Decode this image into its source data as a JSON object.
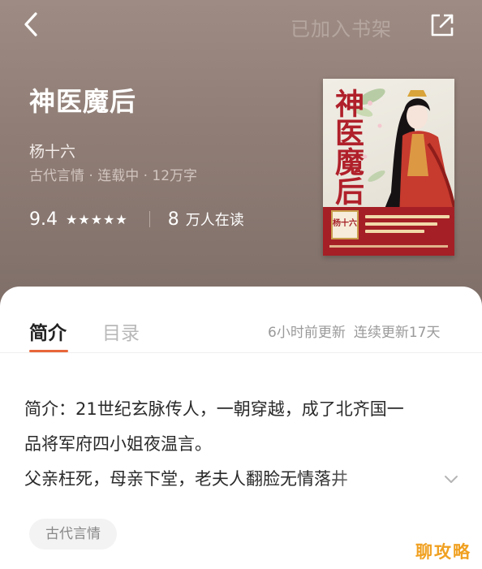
{
  "header": {
    "shelf_label": "已加入书架"
  },
  "book": {
    "title": "神医魔后",
    "author": "杨十六",
    "meta": "古代言情 · 连载中 · 12万字",
    "score": "9.4",
    "stars": "★★★★★",
    "readers_num": "8",
    "readers_label": "万人在读",
    "cover_title": "神医魔后",
    "cover_badge": "杨十六"
  },
  "tabs": [
    {
      "label": "简介",
      "active": true
    },
    {
      "label": "目录",
      "active": false
    }
  ],
  "update": {
    "last_update": "6小时前更新",
    "streak": "连续更新17天"
  },
  "intro": {
    "line1": "简介：21世纪玄脉传人，一朝穿越，成了北齐国一",
    "line2": "品将军府四小姐夜温言。",
    "line3": "父亲枉死，母亲下堂，老夫人翻脸无情落井"
  },
  "tag": "古代言情",
  "watermark": "聊攻略",
  "colors": {
    "accent": "#e8663a",
    "hero": "#8f7d75",
    "cover_red": "#a51f26"
  },
  "icons": [
    "back-arrow-icon",
    "share-icon",
    "chevron-down-icon"
  ]
}
